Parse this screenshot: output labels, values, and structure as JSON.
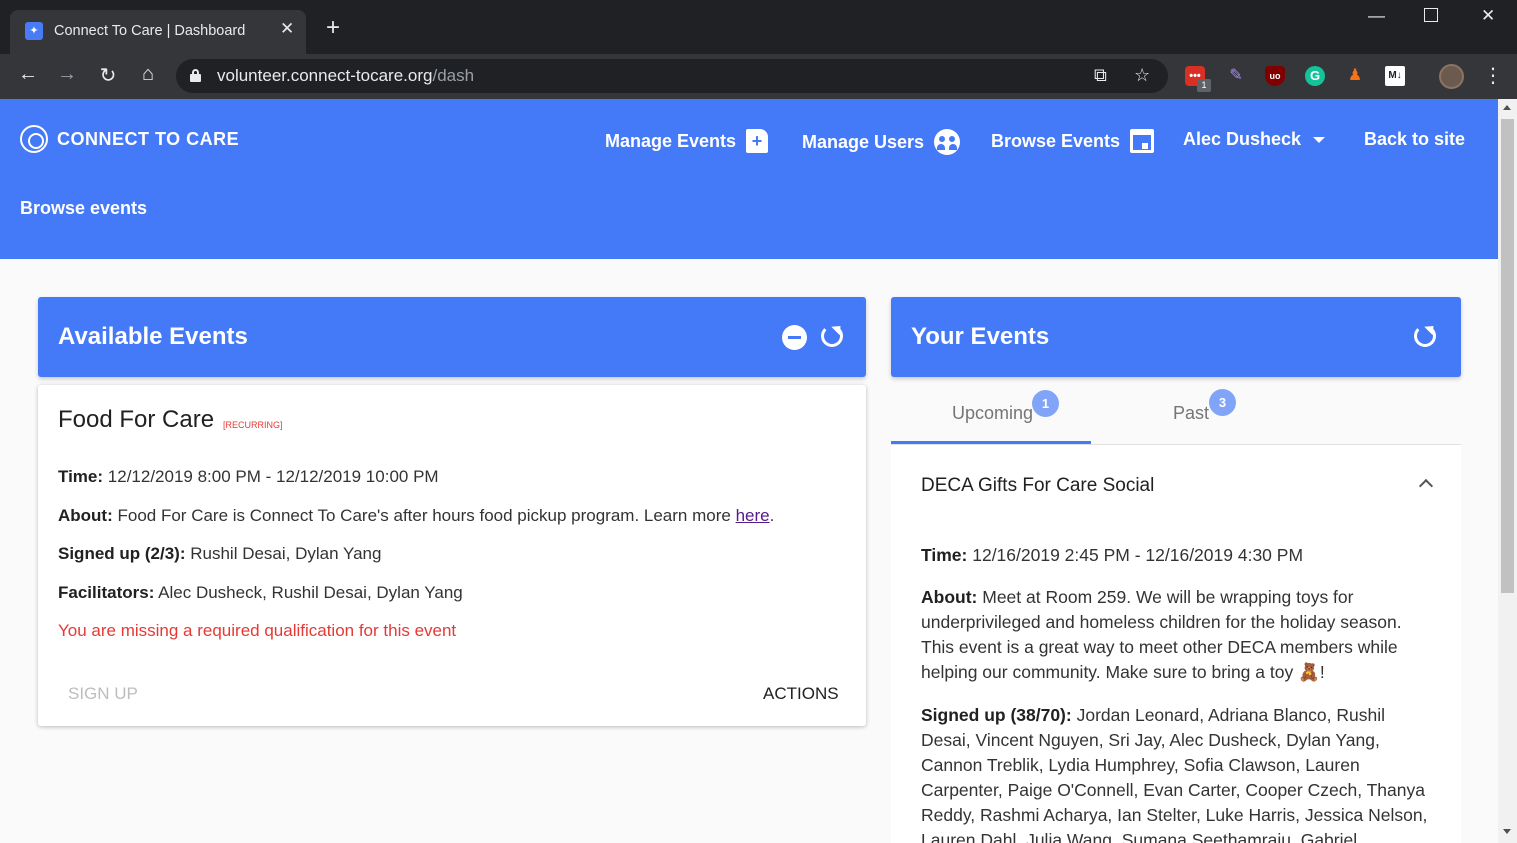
{
  "browser": {
    "tab_title": "Connect To Care | Dashboard",
    "url_host": "volunteer.connect-tocare.org",
    "url_path": "/dash",
    "extension_badge": "1"
  },
  "header": {
    "logo_text": "CONNECT TO CARE",
    "nav": {
      "manage_events": "Manage Events",
      "manage_users": "Manage Users",
      "browse_events": "Browse Events",
      "user_name": "Alec Dusheck",
      "back_to_site": "Back to site"
    },
    "subtitle": "Browse events"
  },
  "available": {
    "title": "Available Events",
    "event": {
      "name": "Food For Care",
      "tag": "[RECURRING]",
      "time_label": "Time:",
      "time": "12/12/2019 8:00 PM - 12/12/2019 10:00 PM",
      "about_label": "About:",
      "about": "Food For Care is Connect To Care's after hours food pickup program. Learn more ",
      "about_link": "here",
      "signed_label": "Signed up (2/3):",
      "signed": "Rushil Desai, Dylan Yang",
      "facilitators_label": "Facilitators:",
      "facilitators": "Alec Dusheck, Rushil Desai, Dylan Yang",
      "warning": "You are missing a required qualification for this event",
      "sign_up": "SIGN UP",
      "actions": "ACTIONS"
    }
  },
  "yours": {
    "title": "Your Events",
    "tabs": [
      {
        "label": "Upcoming",
        "count": "1"
      },
      {
        "label": "Past",
        "count": "3"
      }
    ],
    "event": {
      "name": "DECA Gifts For Care Social",
      "time_label": "Time:",
      "time": "12/16/2019 2:45 PM - 12/16/2019 4:30 PM",
      "about_label": "About:",
      "about": "Meet at Room 259. We will be wrapping toys for underprivileged and homeless children for the holiday season. This event is a great way to meet other DECA members while helping our community. Make sure to bring a toy 🧸!",
      "signed_label": "Signed up (38/70):",
      "signed": "Jordan Leonard, Adriana Blanco, Rushil Desai, Vincent Nguyen, Sri Jay, Alec Dusheck, Dylan Yang, Cannon Treblik, Lydia Humphrey, Sofia Clawson, Lauren Carpenter, Paige O'Connell, Evan Carter, Cooper Czech, Thanya Reddy, Rashmi Acharya, Ian Stelter, Luke Harris, Jessica Nelson, Lauren Dahl, Julia Wang, Sumana Seethamraju, Gabriel"
    }
  },
  "colors": {
    "brand": "#4479f7",
    "warning": "#e53935"
  }
}
